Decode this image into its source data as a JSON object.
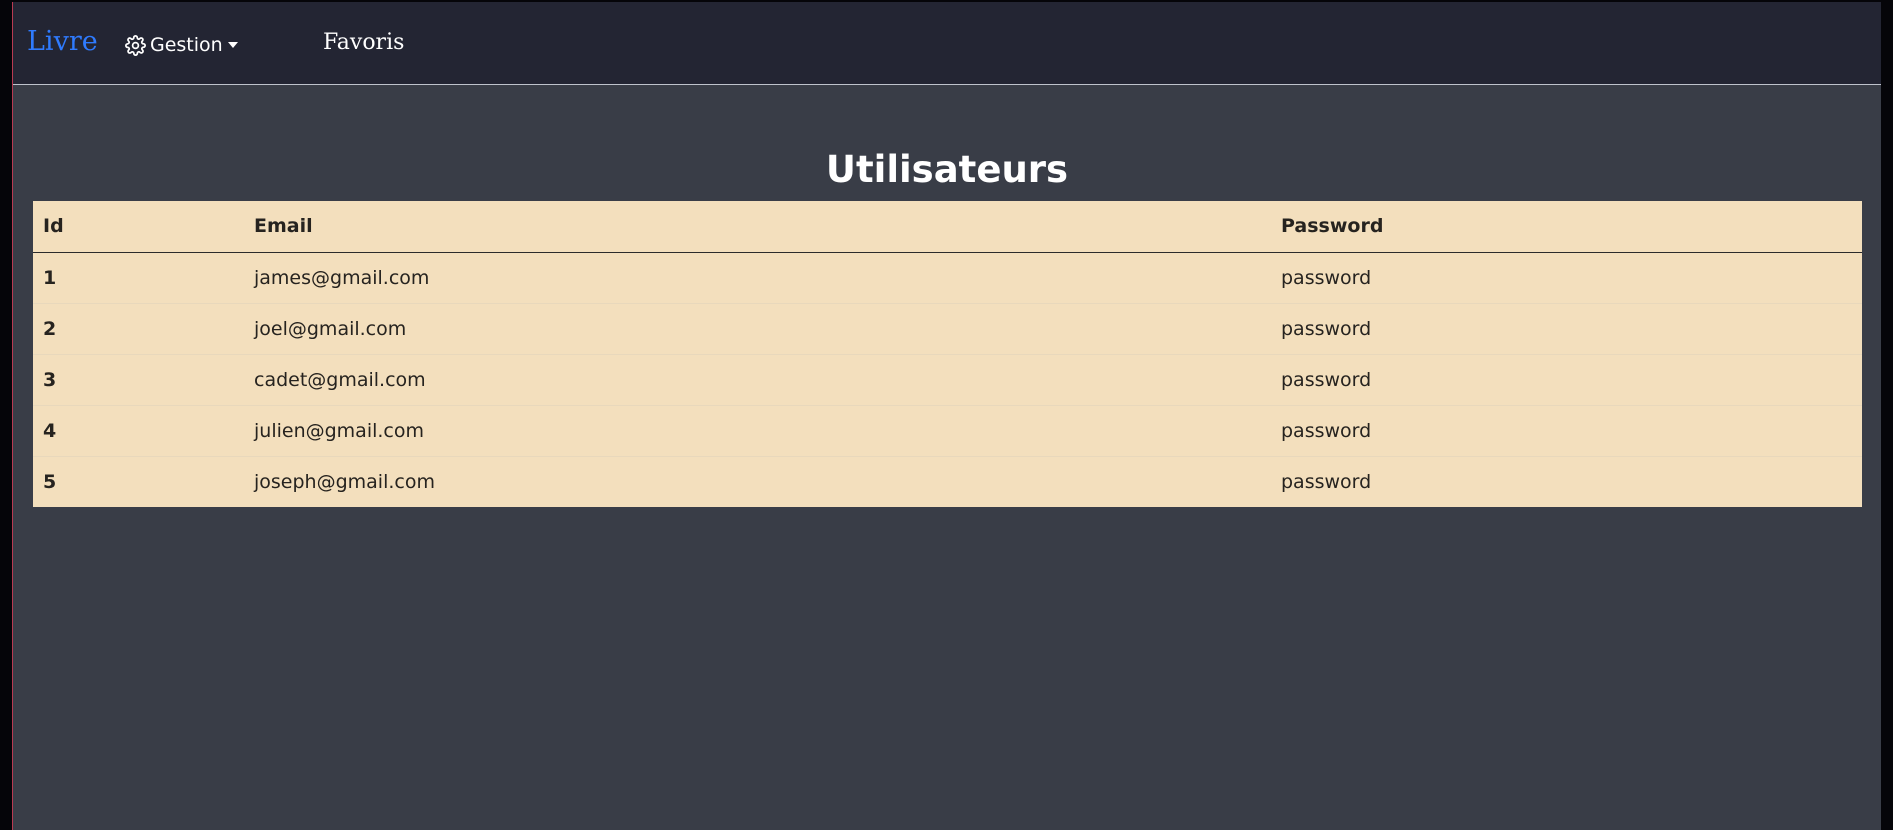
{
  "navbar": {
    "brand": "Livre",
    "gestion_label": "Gestion",
    "favoris_label": "Favoris"
  },
  "main": {
    "title": "Utilisateurs",
    "table": {
      "headers": [
        "Id",
        "Email",
        "Password"
      ],
      "rows": [
        {
          "id": "1",
          "email": "james@gmail.com",
          "password": "password"
        },
        {
          "id": "2",
          "email": "joel@gmail.com",
          "password": "password"
        },
        {
          "id": "3",
          "email": "cadet@gmail.com",
          "password": "password"
        },
        {
          "id": "4",
          "email": "julien@gmail.com",
          "password": "password"
        },
        {
          "id": "5",
          "email": "joseph@gmail.com",
          "password": "password"
        }
      ]
    }
  },
  "colors": {
    "page_background": "#393d47",
    "navbar_background": "#232533",
    "brand": "#2f7bff",
    "table_background": "#f3dfbd"
  },
  "icons": {
    "gestion": "gear-icon",
    "dropdown": "caret-down-icon"
  }
}
